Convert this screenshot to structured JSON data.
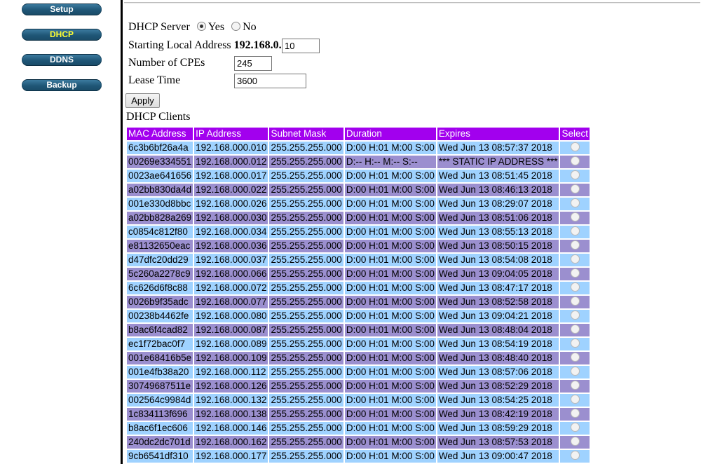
{
  "nav": {
    "items": [
      {
        "label": "Setup"
      },
      {
        "label": "DHCP"
      },
      {
        "label": "DDNS"
      },
      {
        "label": "Backup"
      }
    ]
  },
  "form": {
    "dhcp_server_label": "DHCP Server",
    "yes_label": "Yes",
    "no_label": "No",
    "dhcp_server_value": "Yes",
    "start_label": "Starting Local Address",
    "start_prefix": "192.168.0.",
    "start_value": "10",
    "cpes_label": "Number of CPEs",
    "cpes_value": "245",
    "lease_label": "Lease Time",
    "lease_value": "3600",
    "apply_label": "Apply"
  },
  "clients": {
    "title": "DHCP Clients",
    "headers": [
      "MAC Address",
      "IP Address",
      "Subnet Mask",
      "Duration",
      "Expires",
      "Select"
    ],
    "rows": [
      [
        "6c3b6bf26a4a",
        "192.168.000.010",
        "255.255.255.000",
        "D:00 H:01 M:00 S:00",
        "Wed Jun 13 08:57:37 2018"
      ],
      [
        "00269e334551",
        "192.168.000.012",
        "255.255.255.000",
        "D:-- H:-- M:-- S:--",
        "*** STATIC IP ADDRESS ***"
      ],
      [
        "0023ae641656",
        "192.168.000.017",
        "255.255.255.000",
        "D:00 H:01 M:00 S:00",
        "Wed Jun 13 08:51:45 2018"
      ],
      [
        "a02bb830da4d",
        "192.168.000.022",
        "255.255.255.000",
        "D:00 H:01 M:00 S:00",
        "Wed Jun 13 08:46:13 2018"
      ],
      [
        "001e330d8bbc",
        "192.168.000.026",
        "255.255.255.000",
        "D:00 H:01 M:00 S:00",
        "Wed Jun 13 08:29:07 2018"
      ],
      [
        "a02bb828a269",
        "192.168.000.030",
        "255.255.255.000",
        "D:00 H:01 M:00 S:00",
        "Wed Jun 13 08:51:06 2018"
      ],
      [
        "c0854c812f80",
        "192.168.000.034",
        "255.255.255.000",
        "D:00 H:01 M:00 S:00",
        "Wed Jun 13 08:55:13 2018"
      ],
      [
        "e81132650eac",
        "192.168.000.036",
        "255.255.255.000",
        "D:00 H:01 M:00 S:00",
        "Wed Jun 13 08:50:15 2018"
      ],
      [
        "d47dfc20dd29",
        "192.168.000.037",
        "255.255.255.000",
        "D:00 H:01 M:00 S:00",
        "Wed Jun 13 08:54:08 2018"
      ],
      [
        "5c260a2278c9",
        "192.168.000.066",
        "255.255.255.000",
        "D:00 H:01 M:00 S:00",
        "Wed Jun 13 09:04:05 2018"
      ],
      [
        "6c626d6f8c88",
        "192.168.000.072",
        "255.255.255.000",
        "D:00 H:01 M:00 S:00",
        "Wed Jun 13 08:47:17 2018"
      ],
      [
        "0026b9f35adc",
        "192.168.000.077",
        "255.255.255.000",
        "D:00 H:01 M:00 S:00",
        "Wed Jun 13 08:52:58 2018"
      ],
      [
        "00238b4462fe",
        "192.168.000.080",
        "255.255.255.000",
        "D:00 H:01 M:00 S:00",
        "Wed Jun 13 09:04:21 2018"
      ],
      [
        "b8ac6f4cad82",
        "192.168.000.087",
        "255.255.255.000",
        "D:00 H:01 M:00 S:00",
        "Wed Jun 13 08:48:04 2018"
      ],
      [
        "ec1f72bac0f7",
        "192.168.000.089",
        "255.255.255.000",
        "D:00 H:01 M:00 S:00",
        "Wed Jun 13 08:54:19 2018"
      ],
      [
        "001e68416b5e",
        "192.168.000.109",
        "255.255.255.000",
        "D:00 H:01 M:00 S:00",
        "Wed Jun 13 08:48:40 2018"
      ],
      [
        "001e4fb38a20",
        "192.168.000.112",
        "255.255.255.000",
        "D:00 H:01 M:00 S:00",
        "Wed Jun 13 08:57:06 2018"
      ],
      [
        "30749687511e",
        "192.168.000.126",
        "255.255.255.000",
        "D:00 H:01 M:00 S:00",
        "Wed Jun 13 08:52:29 2018"
      ],
      [
        "002564c9984d",
        "192.168.000.132",
        "255.255.255.000",
        "D:00 H:01 M:00 S:00",
        "Wed Jun 13 08:54:25 2018"
      ],
      [
        "1c834113f696",
        "192.168.000.138",
        "255.255.255.000",
        "D:00 H:01 M:00 S:00",
        "Wed Jun 13 08:42:19 2018"
      ],
      [
        "b8ac6f1ec606",
        "192.168.000.146",
        "255.255.255.000",
        "D:00 H:01 M:00 S:00",
        "Wed Jun 13 08:59:29 2018"
      ],
      [
        "240dc2dc701d",
        "192.168.000.162",
        "255.255.255.000",
        "D:00 H:01 M:00 S:00",
        "Wed Jun 13 08:57:53 2018"
      ],
      [
        "9cb6541df310",
        "192.168.000.177",
        "255.255.255.000",
        "D:00 H:01 M:00 S:00",
        "Wed Jun 13 09:00:47 2018"
      ]
    ]
  },
  "colors": {
    "header_bg": "#a200ee",
    "row_odd": "#9fd2ff",
    "row_even": "#9b8fcf",
    "nav_btn": "#1f5676",
    "nav_active_text": "#ffff33"
  }
}
